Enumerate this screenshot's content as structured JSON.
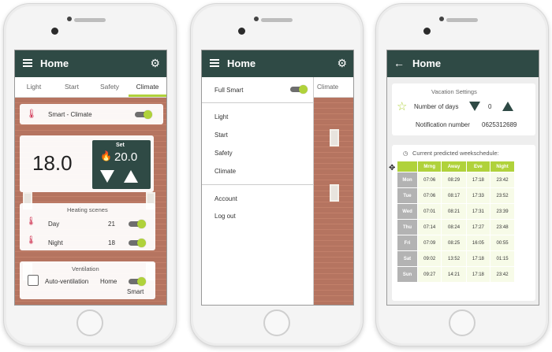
{
  "phone1": {
    "title": "Home",
    "tabs": [
      "Light",
      "Start",
      "Safety",
      "Climate"
    ],
    "smart_climate_label": "Smart - Climate",
    "current_temp": "18.0",
    "set_label": "Set",
    "set_temp": "20.0",
    "heating_scenes_title": "Heating scenes",
    "scenes": [
      {
        "label": "Day",
        "value": "21"
      },
      {
        "label": "Night",
        "value": "18"
      }
    ],
    "ventilation_title": "Ventilation",
    "ventilation_label": "Auto-ventilation",
    "ventilation_mode": "Home",
    "ventilation_toggle_label": "Smart"
  },
  "phone2": {
    "title": "Home",
    "full_smart_label": "Full Smart",
    "partial_tab": "Climate",
    "menu_items": [
      "Light",
      "Start",
      "Safety",
      "Climate"
    ],
    "menu_items_2": [
      "Account",
      "Log out"
    ]
  },
  "phone3": {
    "title": "Home",
    "vacation_title": "Vacation Settings",
    "days_label": "Number of days",
    "days_value": "0",
    "notification_label": "Notification number",
    "notification_value": "0625312689",
    "schedule_title": "Current predicted weekschedule:",
    "columns": [
      "Mrng",
      "Away",
      "Eve",
      "Night"
    ],
    "rows": [
      {
        "day": "Mon",
        "vals": [
          "07:06",
          "08:29",
          "17:18",
          "23:42"
        ]
      },
      {
        "day": "Tue",
        "vals": [
          "07:06",
          "08:17",
          "17:33",
          "23:52"
        ]
      },
      {
        "day": "Wed",
        "vals": [
          "07:01",
          "08:21",
          "17:31",
          "23:39"
        ]
      },
      {
        "day": "Thu",
        "vals": [
          "07:14",
          "08:24",
          "17:27",
          "23:48"
        ]
      },
      {
        "day": "Fri",
        "vals": [
          "07:09",
          "08:25",
          "16:05",
          "00:55"
        ]
      },
      {
        "day": "Sat",
        "vals": [
          "09:02",
          "13:52",
          "17:18",
          "01:15"
        ]
      },
      {
        "day": "Sun",
        "vals": [
          "09:27",
          "14:21",
          "17:18",
          "23:42"
        ]
      }
    ]
  },
  "colors": {
    "header": "#2f4a45",
    "accent": "#b0d23b",
    "set_panel": "#2f4a45"
  }
}
